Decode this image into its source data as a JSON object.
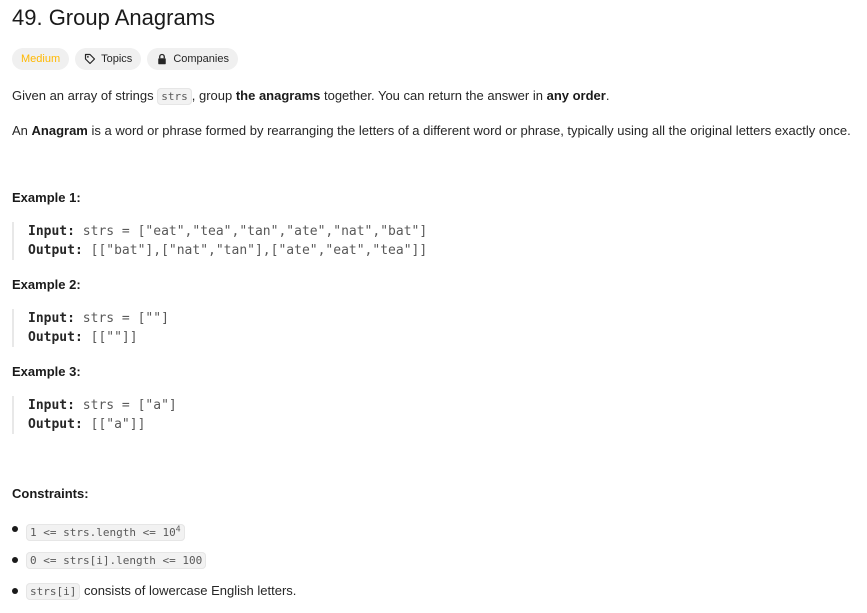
{
  "title": "49. Group Anagrams",
  "tags": {
    "difficulty": "Medium",
    "topics": "Topics",
    "companies": "Companies"
  },
  "description": {
    "p1": {
      "t1": "Given an array of strings ",
      "code1": "strs",
      "t2": ", group ",
      "b1": "the anagrams",
      "t3": " together. You can return the answer in ",
      "b2": "any order",
      "t4": "."
    },
    "p2": {
      "t1": "An ",
      "b1": "Anagram",
      "t2": " is a word or phrase formed by rearranging the letters of a different word or phrase, typically using all the original letters exactly once."
    }
  },
  "examples": [
    {
      "title": "Example 1:",
      "input_label": "Input:",
      "input": "strs = [\"eat\",\"tea\",\"tan\",\"ate\",\"nat\",\"bat\"]",
      "output_label": "Output:",
      "output": "[[\"bat\"],[\"nat\",\"tan\"],[\"ate\",\"eat\",\"tea\"]]"
    },
    {
      "title": "Example 2:",
      "input_label": "Input:",
      "input": "strs = [\"\"]",
      "output_label": "Output:",
      "output": "[[\"\"]]"
    },
    {
      "title": "Example 3:",
      "input_label": "Input:",
      "input": "strs = [\"a\"]",
      "output_label": "Output:",
      "output": "[[\"a\"]]"
    }
  ],
  "constraints": {
    "title": "Constraints:",
    "c1_code": "1 <= strs.length <= 10",
    "c1_sup": "4",
    "c2_code": "0 <= strs[i].length <= 100",
    "c3_code": "strs[i]",
    "c3_text": " consists of lowercase English letters."
  },
  "colors": {
    "medium": "#ffb800",
    "text": "#262626",
    "code_bg": "#f2f2f2"
  },
  "icons": {
    "topics": "tag-icon",
    "companies": "lock-icon"
  }
}
